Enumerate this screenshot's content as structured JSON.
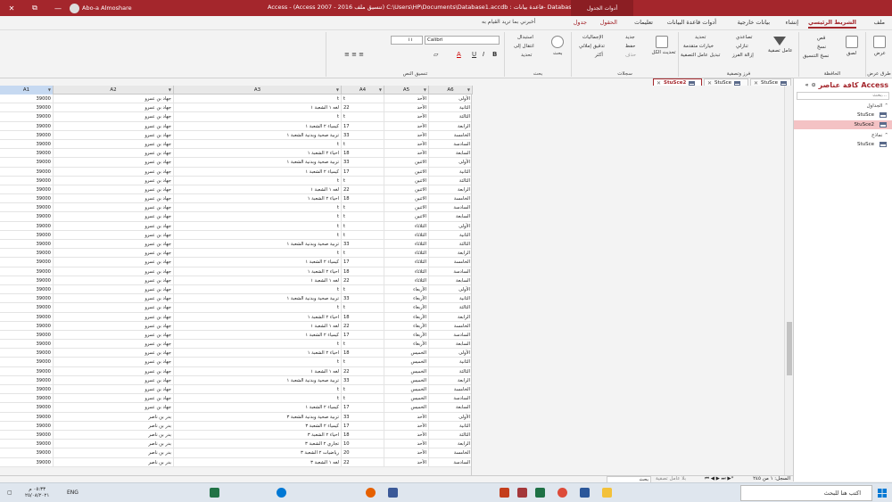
{
  "titlebar": {
    "user": "Abo-a Almoshare",
    "title": "Access  -  (Access 2007 - 2016 تنسيق ملف) C:\\Users\\HP\\Documents\\Database1.accdb : قاعدة بيانات- Database1",
    "context_tab": "أدوات الجدول",
    "close": "✕",
    "maximize": "❐",
    "minimize": "—",
    "restore": "⧉"
  },
  "tabs": [
    "ملف",
    "الشريط الرئيسي",
    "إنشاء",
    "بيانات خارجية",
    "أدوات قاعدة البيانات",
    "تعليمات",
    "الحقول",
    "جدول"
  ],
  "tellme": "أخبرني بما تريد القيام به",
  "ribbon": {
    "views": {
      "label": "طرق عرض",
      "btn": "عرض"
    },
    "clipboard": {
      "label": "الحافظة",
      "paste": "لصق",
      "cut": "قص",
      "copy": "نسخ",
      "painter": "نسخ التنسيق"
    },
    "sort": {
      "label": "فرز وتصفية",
      "filter": "عامل تصفية",
      "asc": "تصاعدي",
      "desc": "تنازلي",
      "remove": "إزالة الفرز",
      "selection": "تحديد",
      "advanced": "خيارات متقدمة",
      "toggle": "تبديل عامل التصفية"
    },
    "records": {
      "label": "سجلات",
      "refresh": "تحديث الكل",
      "new": "جديد",
      "save": "حفظ",
      "delete": "حذف",
      "totals": "الإجماليات",
      "spelling": "تدقيق إملائي",
      "more": "أكثر"
    },
    "find": {
      "label": "بحث",
      "find": "بحث",
      "replace": "استبدال",
      "goto": "انتقال إلى",
      "select": "تحديد"
    },
    "text": {
      "label": "تنسيق النص",
      "font": "Calibri",
      "size": "١١"
    }
  },
  "nav": {
    "title": "كافة عناصر Access",
    "search_placeholder": "بحث...",
    "sections": [
      {
        "name": "الجداول",
        "items": [
          "StuSce",
          "StuSce2"
        ]
      },
      {
        "name": "نماذج",
        "items": [
          "StuSce"
        ]
      }
    ]
  },
  "doctabs": [
    "StuSce2",
    "StuSce",
    "StuSce"
  ],
  "columns": [
    "A1",
    "A2",
    "A3",
    "A4",
    "A5",
    "A6"
  ],
  "rows": [
    [
      "39000",
      "جهاد بن عمرو",
      "t",
      "t",
      "الأحد",
      "الأولى"
    ],
    [
      "39000",
      "جهاد بن عمرو",
      "لغه ١ الشعبة ١",
      "22",
      "الأحد",
      "الثانية"
    ],
    [
      "39000",
      "جهاد بن عمرو",
      "t",
      "t",
      "الأحد",
      "الثالثة"
    ],
    [
      "39000",
      "جهاد بن عمرو",
      "كيمياء ٢ الشعبة ١",
      "17",
      "الأحد",
      "الرابعة"
    ],
    [
      "39000",
      "جهاد بن عمرو",
      "تربية صحية وبدنية الشعبة ١",
      "33",
      "الأحد",
      "الخامسة"
    ],
    [
      "39000",
      "جهاد بن عمرو",
      "t",
      "t",
      "الأحد",
      "السادسة"
    ],
    [
      "39000",
      "جهاد بن عمرو",
      "احياء ٢ الشعبة ١",
      "18",
      "الأحد",
      "السابعة"
    ],
    [
      "39000",
      "جهاد بن عمرو",
      "تربية صحية وبدنية الشعبة ١",
      "33",
      "الاثنين",
      "الأولى"
    ],
    [
      "39000",
      "جهاد بن عمرو",
      "كيمياء ٢ الشعبة ١",
      "17",
      "الاثنين",
      "الثانية"
    ],
    [
      "39000",
      "جهاد بن عمرو",
      "t",
      "t",
      "الاثنين",
      "الثالثة"
    ],
    [
      "39000",
      "جهاد بن عمرو",
      "لغه ١ الشعبة ١",
      "22",
      "الاثنين",
      "الرابعة"
    ],
    [
      "39000",
      "جهاد بن عمرو",
      "احياء ٢ الشعبة ١",
      "18",
      "الاثنين",
      "الخامسة"
    ],
    [
      "39000",
      "جهاد بن عمرو",
      "t",
      "t",
      "الاثنين",
      "السادسة"
    ],
    [
      "39000",
      "جهاد بن عمرو",
      "t",
      "t",
      "الاثنين",
      "السابعة"
    ],
    [
      "39000",
      "جهاد بن عمرو",
      "t",
      "t",
      "الثلاثاء",
      "الأولى"
    ],
    [
      "39000",
      "جهاد بن عمرو",
      "t",
      "t",
      "الثلاثاء",
      "الثانية"
    ],
    [
      "39000",
      "جهاد بن عمرو",
      "تربية صحية وبدنية الشعبة ١",
      "33",
      "الثلاثاء",
      "الثالثة"
    ],
    [
      "39000",
      "جهاد بن عمرو",
      "t",
      "t",
      "الثلاثاء",
      "الرابعة"
    ],
    [
      "39000",
      "جهاد بن عمرو",
      "كيمياء ٢ الشعبة ١",
      "17",
      "الثلاثاء",
      "الخامسة"
    ],
    [
      "39000",
      "جهاد بن عمرو",
      "احياء ٢ الشعبة ١",
      "18",
      "الثلاثاء",
      "السادسة"
    ],
    [
      "39000",
      "جهاد بن عمرو",
      "لغه ١ الشعبة ١",
      "22",
      "الثلاثاء",
      "السابعة"
    ],
    [
      "39000",
      "جهاد بن عمرو",
      "t",
      "t",
      "الأربعاء",
      "الأولى"
    ],
    [
      "39000",
      "جهاد بن عمرو",
      "تربية صحية وبدنية الشعبة ١",
      "33",
      "الأربعاء",
      "الثانية"
    ],
    [
      "39000",
      "جهاد بن عمرو",
      "t",
      "t",
      "الأربعاء",
      "الثالثة"
    ],
    [
      "39000",
      "جهاد بن عمرو",
      "احياء ٢ الشعبة ١",
      "18",
      "الأربعاء",
      "الرابعة"
    ],
    [
      "39000",
      "جهاد بن عمرو",
      "لغه ١ الشعبة ١",
      "22",
      "الأربعاء",
      "الخامسة"
    ],
    [
      "39000",
      "جهاد بن عمرو",
      "كيمياء ٢ الشعبة ١",
      "17",
      "الأربعاء",
      "السادسة"
    ],
    [
      "39000",
      "جهاد بن عمرو",
      "t",
      "t",
      "الأربعاء",
      "السابعة"
    ],
    [
      "39000",
      "جهاد بن عمرو",
      "احياء ٢ الشعبة ١",
      "18",
      "الخميس",
      "الأولى"
    ],
    [
      "39000",
      "جهاد بن عمرو",
      "t",
      "t",
      "الخميس",
      "الثانية"
    ],
    [
      "39000",
      "جهاد بن عمرو",
      "لغه ١ الشعبة ١",
      "22",
      "الخميس",
      "الثالثة"
    ],
    [
      "39000",
      "جهاد بن عمرو",
      "تربية صحية وبدنية الشعبة ١",
      "33",
      "الخميس",
      "الرابعة"
    ],
    [
      "39000",
      "جهاد بن عمرو",
      "t",
      "t",
      "الخميس",
      "الخامسة"
    ],
    [
      "39000",
      "جهاد بن عمرو",
      "t",
      "t",
      "الخميس",
      "السادسة"
    ],
    [
      "39000",
      "جهاد بن عمرو",
      "كيمياء ٢ الشعبة ١",
      "17",
      "الخميس",
      "السابعة"
    ],
    [
      "39000",
      "بدر بن ناصر",
      "تربية صحية وبدنية الشعبة ٣",
      "33",
      "الأحد",
      "الأولى"
    ],
    [
      "39000",
      "بدر بن ناصر",
      "كيمياء ٢ الشعبة ٣",
      "17",
      "الأحد",
      "الثانية"
    ],
    [
      "39000",
      "بدر بن ناصر",
      "احياء ٢ الشعبة ٣",
      "18",
      "الأحد",
      "الثالثة"
    ],
    [
      "39000",
      "بدر بن ناصر",
      "تجاري ٢ الشعبة ٣",
      "10",
      "الأحد",
      "الرابعة"
    ],
    [
      "39000",
      "بدر بن ناصر",
      "رياضيات ٢ الشعبة ٣",
      "20",
      "الأحد",
      "الخامسة"
    ],
    [
      "39000",
      "بدر بن ناصر",
      "لغه ١ الشعبة ٣",
      "22",
      "الأحد",
      "السادسة"
    ]
  ],
  "recnav": {
    "record": "السجل: ١ من ٢٤٥",
    "nofilter": "بلا عامل تصفية",
    "search": "بحث",
    "nav_arrows": "⏮ ◀ ▶ ⏭ ▶*"
  },
  "taskbar": {
    "search": "اكتب هنا للبحث",
    "time": "٠٥:٣٣ م",
    "date": "٢٥/٠٨/٢٠٢١",
    "tray": "ENG"
  }
}
